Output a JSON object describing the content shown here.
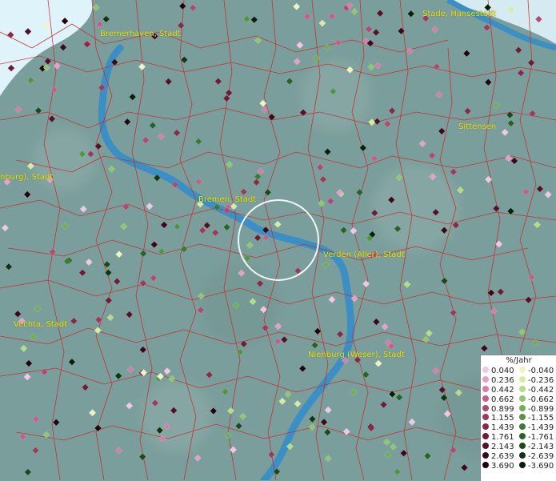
{
  "colors": {
    "background": "#7a9e9b",
    "river": "#3b8fc4",
    "boundary": "#cc2a2a",
    "label": "#e8e800"
  },
  "places": [
    "Bremerhaven, Stadt",
    "Stade, Hansestadt",
    "Sittensen",
    "nburg), Stadt",
    "Bremen, Stadt",
    "Verden (Aller), Stadt",
    "Vechta, Stadt",
    "Nienburg (Weser), Stadt"
  ],
  "legend": {
    "title": "%/Jahr",
    "positive": [
      {
        "label": "0.040",
        "color": "#f4c6e6"
      },
      {
        "label": "0.236",
        "color": "#e6a0c8"
      },
      {
        "label": "0.442",
        "color": "#d47ea8"
      },
      {
        "label": "0.662",
        "color": "#c2608c"
      },
      {
        "label": "0.899",
        "color": "#b04a72"
      },
      {
        "label": "1.155",
        "color": "#9c3a5c"
      },
      {
        "label": "1.439",
        "color": "#862a48"
      },
      {
        "label": "1.761",
        "color": "#6e1c36"
      },
      {
        "label": "2.143",
        "color": "#541026"
      },
      {
        "label": "2.639",
        "color": "#3a0818"
      },
      {
        "label": "3.690",
        "color": "#22040c"
      }
    ],
    "negative": [
      {
        "label": "-0.040",
        "color": "#f0f4c0"
      },
      {
        "label": "-0.236",
        "color": "#d6eca0"
      },
      {
        "label": "-0.442",
        "color": "#b6dc86"
      },
      {
        "label": "-0.662",
        "color": "#92c66e"
      },
      {
        "label": "-0.899",
        "color": "#70ae58"
      },
      {
        "label": "-1.155",
        "color": "#529444"
      },
      {
        "label": "-1.439",
        "color": "#3a7a34"
      },
      {
        "label": "-1.761",
        "color": "#286226"
      },
      {
        "label": "-2.143",
        "color": "#1a4a1a"
      },
      {
        "label": "-2.639",
        "color": "#0e3410"
      },
      {
        "label": "-3.690",
        "color": "#062006"
      }
    ]
  }
}
